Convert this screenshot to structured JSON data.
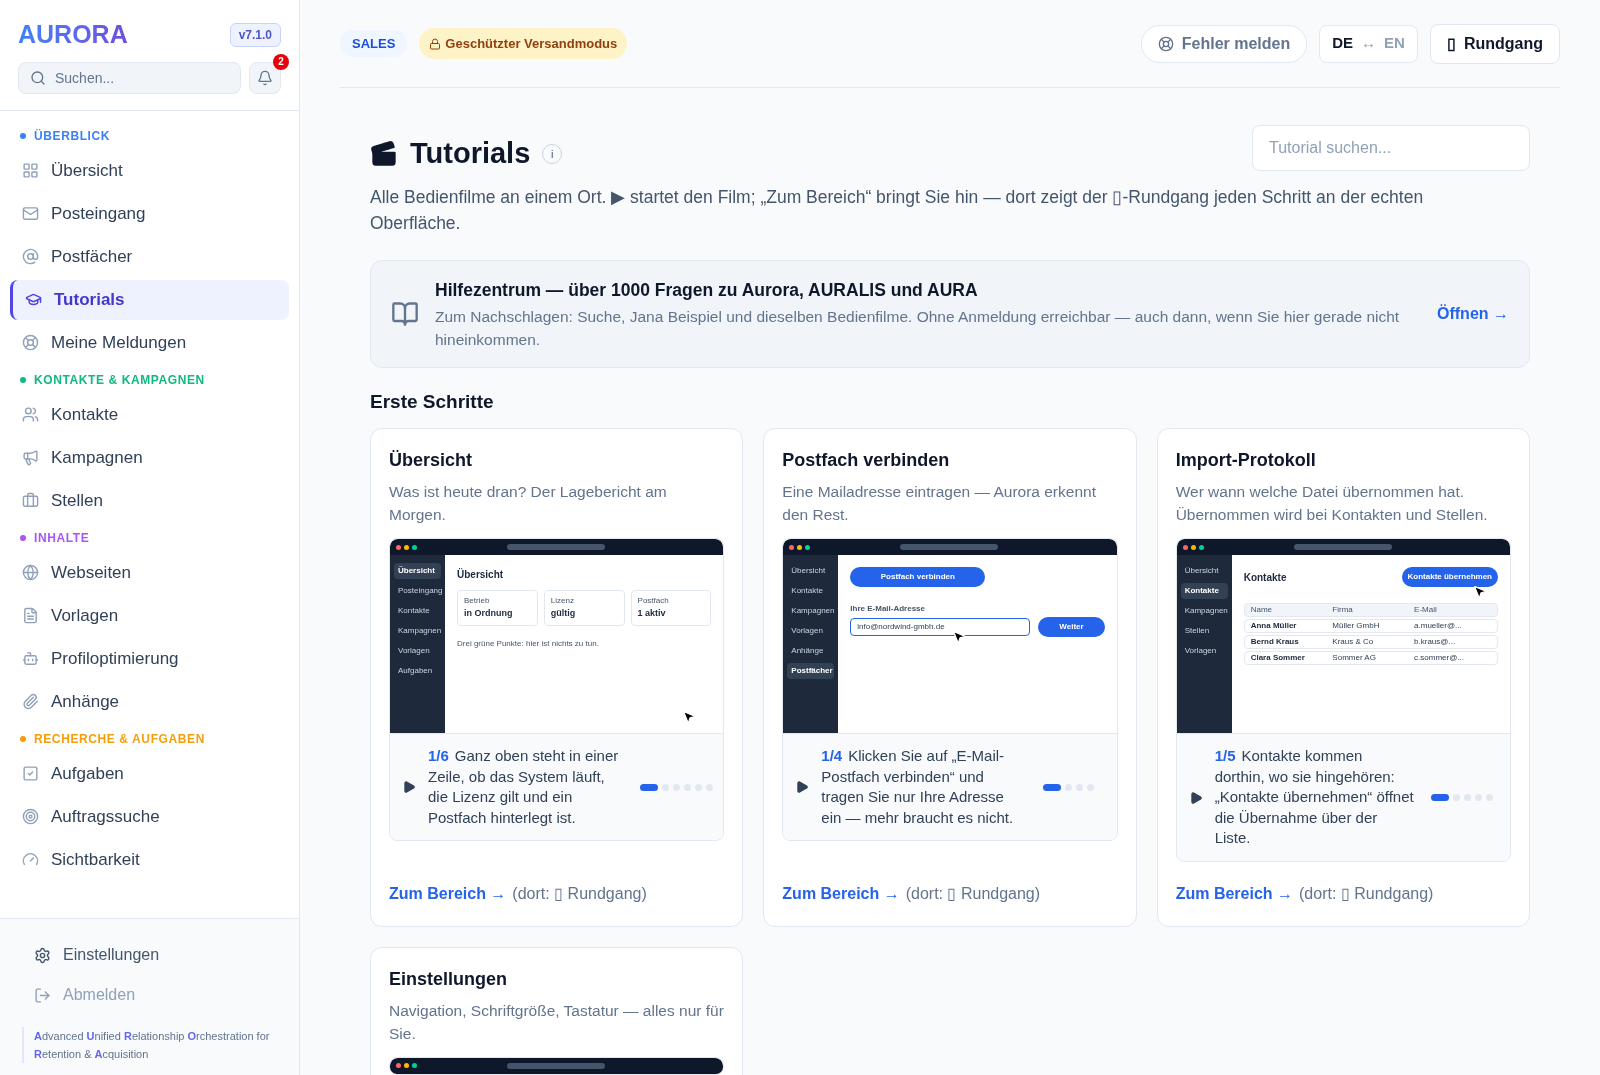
{
  "sidebar": {
    "logo": "AURORA",
    "version": "v7.1.0",
    "search": {
      "placeholder": "Suchen..."
    },
    "notifications": "2",
    "sections": [
      {
        "title": "ÜBERBLICK",
        "color": "#3b82f6",
        "items": [
          {
            "label": "Übersicht",
            "selected": false
          },
          {
            "label": "Posteingang",
            "selected": false
          },
          {
            "label": "Postfächer",
            "selected": false
          },
          {
            "label": "Tutorials",
            "selected": true
          },
          {
            "label": "Meine Meldungen",
            "selected": false
          }
        ]
      },
      {
        "title": "KONTAKTE & KAMPAGNEN",
        "color": "#10b981",
        "items": [
          {
            "label": "Kontakte",
            "selected": false
          },
          {
            "label": "Kampagnen",
            "selected": false
          },
          {
            "label": "Stellen",
            "selected": false
          }
        ]
      },
      {
        "title": "INHALTE",
        "color": "#a855f7",
        "items": [
          {
            "label": "Webseiten",
            "selected": false
          },
          {
            "label": "Vorlagen",
            "selected": false
          },
          {
            "label": "Profiloptimierung",
            "selected": false
          },
          {
            "label": "Anhänge",
            "selected": false
          }
        ]
      },
      {
        "title": "RECHERCHE & AUFGABEN",
        "color": "#f59e0b",
        "items": [
          {
            "label": "Aufgaben",
            "selected": false
          },
          {
            "label": "Auftragssuche",
            "selected": false
          },
          {
            "label": "Sichtbarkeit",
            "selected": false
          }
        ]
      }
    ],
    "footer_items": [
      {
        "label": "Einstellungen",
        "disabled": false
      },
      {
        "label": "Abmelden",
        "disabled": true
      }
    ],
    "tagline": [
      {
        "text": "A",
        "accent": true
      },
      {
        "text": "dvanced ",
        "accent": false
      },
      {
        "text": "U",
        "accent": true
      },
      {
        "text": "nified ",
        "accent": false
      },
      {
        "text": "R",
        "accent": true
      },
      {
        "text": "elationship ",
        "accent": false
      },
      {
        "text": "O",
        "accent": true
      },
      {
        "text": "rchestration for ",
        "accent": false
      },
      {
        "text": "R",
        "accent": true
      },
      {
        "text": "etention & ",
        "accent": false
      },
      {
        "text": "A",
        "accent": true
      },
      {
        "text": "cquisition",
        "accent": false
      }
    ]
  },
  "header": {
    "role": "SALES",
    "mode": "Geschützter Versandmodus",
    "report": "Fehler melden",
    "lang_active": "DE",
    "lang_arrow": "↔",
    "lang_other": "EN",
    "tour_icon": "▯",
    "tour": "Rundgang"
  },
  "page": {
    "title": "Tutorials",
    "info": "i",
    "search": {
      "placeholder": "Tutorial suchen..."
    },
    "intro": "Alle Bedienfilme an einem Ort. ▶ startet den Film; „Zum Bereich“ bringt Sie hin — dort zeigt der ▯-Rundgang jeden Schritt an der echten Oberfläche.",
    "help": {
      "title": "Hilfezentrum — über 1000 Fragen zu Aurora, AURALIS und AURA",
      "text": "Zum Nachschlagen: Suche, Jana Beispiel und dieselben Bedienfilme. Ohne Anmeldung erreichbar — auch dann, wenn Sie hier gerade nicht hineinkommen.",
      "link": "Öffnen →"
    },
    "section": "Erste Schritte",
    "cards": [
      {
        "title": "Übersicht",
        "text": "Was ist heute dran? Der Lagebericht am Morgen.",
        "preview": {
          "kind": "overview",
          "nav": [
            {
              "label": "Übersicht",
              "selected": true
            },
            {
              "label": "Posteingang",
              "selected": false
            },
            {
              "label": "Kontakte",
              "selected": false
            },
            {
              "label": "Kampagnen",
              "selected": false
            },
            {
              "label": "Vorlagen",
              "selected": false
            },
            {
              "label": "Aufgaben",
              "selected": false
            }
          ],
          "heading": "Übersicht",
          "tiles": [
            {
              "label": "Betrieb",
              "value": "in Ordnung"
            },
            {
              "label": "Lizenz",
              "value": "gültig"
            },
            {
              "label": "Postfach",
              "value": "1 aktiv"
            }
          ],
          "note": "Drei grüne Punkte: hier ist nichts zu tun."
        },
        "step": "1/6",
        "caption": "Ganz oben steht in einer Zeile, ob das System läuft, die Lizenz gilt und ein Postfach hinterlegt ist.",
        "dots": [
          true,
          false,
          false,
          false,
          false,
          false
        ],
        "link": "Zum Bereich →",
        "where": "(dort: ▯ Rundgang)"
      },
      {
        "title": "Postfach verbinden",
        "text": "Eine Mailadresse eintragen — Aurora erkennt den Rest.",
        "preview": {
          "kind": "connect",
          "nav": [
            {
              "label": "Übersicht",
              "selected": false
            },
            {
              "label": "Kontakte",
              "selected": false
            },
            {
              "label": "Kampagnen",
              "selected": false
            },
            {
              "label": "Vorlagen",
              "selected": false
            },
            {
              "label": "Anhänge",
              "selected": false
            },
            {
              "label": "Postfächer",
              "selected": true
            }
          ],
          "button": "Postfach verbinden",
          "field_label": "Ihre E-Mail-Adresse",
          "value": "info@nordwind-gmbh.de",
          "submit": "Weiter"
        },
        "step": "1/4",
        "caption": "Klicken Sie auf „E-Mail-Postfach verbinden“ und tragen Sie nur Ihre Adresse ein — mehr braucht es nicht.",
        "dots": [
          true,
          false,
          false,
          false
        ],
        "link": "Zum Bereich →",
        "where": "(dort: ▯ Rundgang)"
      },
      {
        "title": "Import-Protokoll",
        "text": "Wer wann welche Datei übernommen hat. Übernommen wird bei Kontakten und Stellen.",
        "preview": {
          "kind": "table",
          "nav": [
            {
              "label": "Übersicht",
              "selected": false
            },
            {
              "label": "Kontakte",
              "selected": true
            },
            {
              "label": "Kampagnen",
              "selected": false
            },
            {
              "label": "Stellen",
              "selected": false
            },
            {
              "label": "Vorlagen",
              "selected": false
            }
          ],
          "heading": "Kontakte",
          "button": "Kontakte übernehmen",
          "columns": [
            "Name",
            "Firma",
            "E-Mail"
          ],
          "rows": [
            [
              "Anna Müller",
              "Müller GmbH",
              "a.mueller@..."
            ],
            [
              "Bernd Kraus",
              "Kraus & Co",
              "b.kraus@..."
            ],
            [
              "Clara Sommer",
              "Sommer AG",
              "c.sommer@..."
            ]
          ]
        },
        "step": "1/5",
        "caption": "Kontakte kommen dorthin, wo sie hingehören: „Kontakte übernehmen“ öffnet die Übernahme über der Liste.",
        "dots": [
          true,
          false,
          false,
          false,
          false
        ],
        "link": "Zum Bereich →",
        "where": "(dort: ▯ Rundgang)"
      },
      {
        "title": "Einstellungen",
        "text": "Navigation, Schriftgröße, Tastatur — alles nur für Sie.",
        "preview": {
          "kind": "cut"
        }
      }
    ]
  }
}
